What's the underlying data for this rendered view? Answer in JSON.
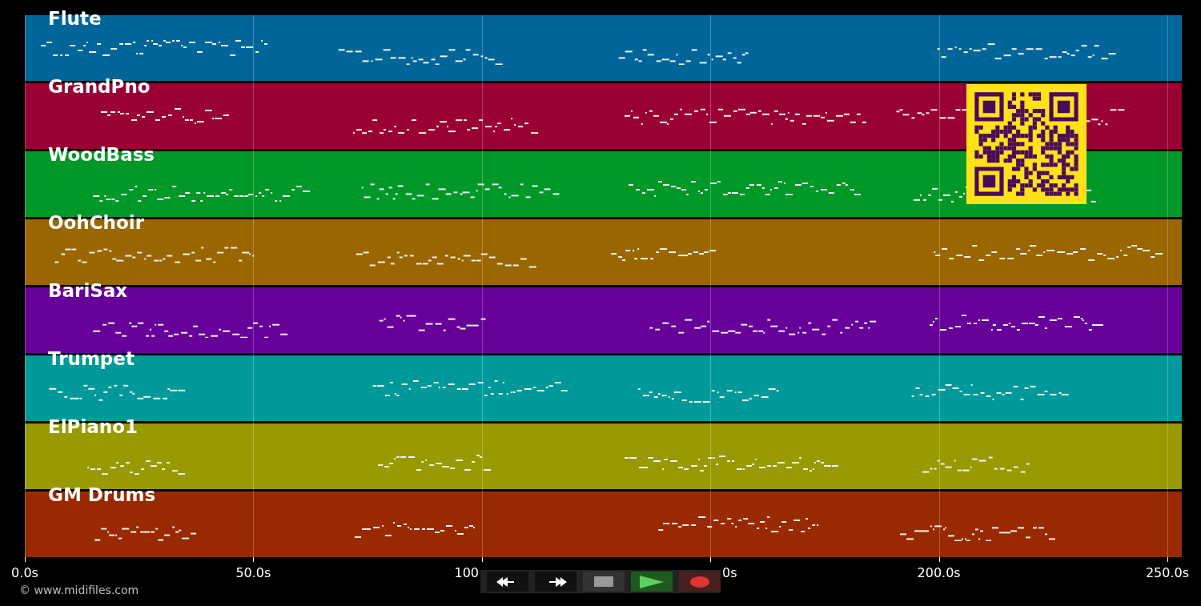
{
  "tracks": [
    {
      "name": "Flute",
      "color": "#006699"
    },
    {
      "name": "GrandPno",
      "color": "#990033"
    },
    {
      "name": "WoodBass",
      "color": "#009929"
    },
    {
      "name": "OohChoir",
      "color": "#996600"
    },
    {
      "name": "BariSax",
      "color": "#660099"
    },
    {
      "name": "Trumpet",
      "color": "#009999"
    },
    {
      "name": "ElPiano1",
      "color": "#999900"
    },
    {
      "name": "GM Drums",
      "color": "#992900"
    }
  ],
  "time_axis": [
    {
      "label": "0.0s",
      "covered": false
    },
    {
      "label": "50.0s",
      "covered": false
    },
    {
      "label": "100",
      "covered": true
    },
    {
      "label": "0s",
      "covered": true
    },
    {
      "label": "200.0s",
      "covered": false
    },
    {
      "label": "250.0s",
      "covered": false
    }
  ],
  "copyright": "© www.midifiles.com"
}
